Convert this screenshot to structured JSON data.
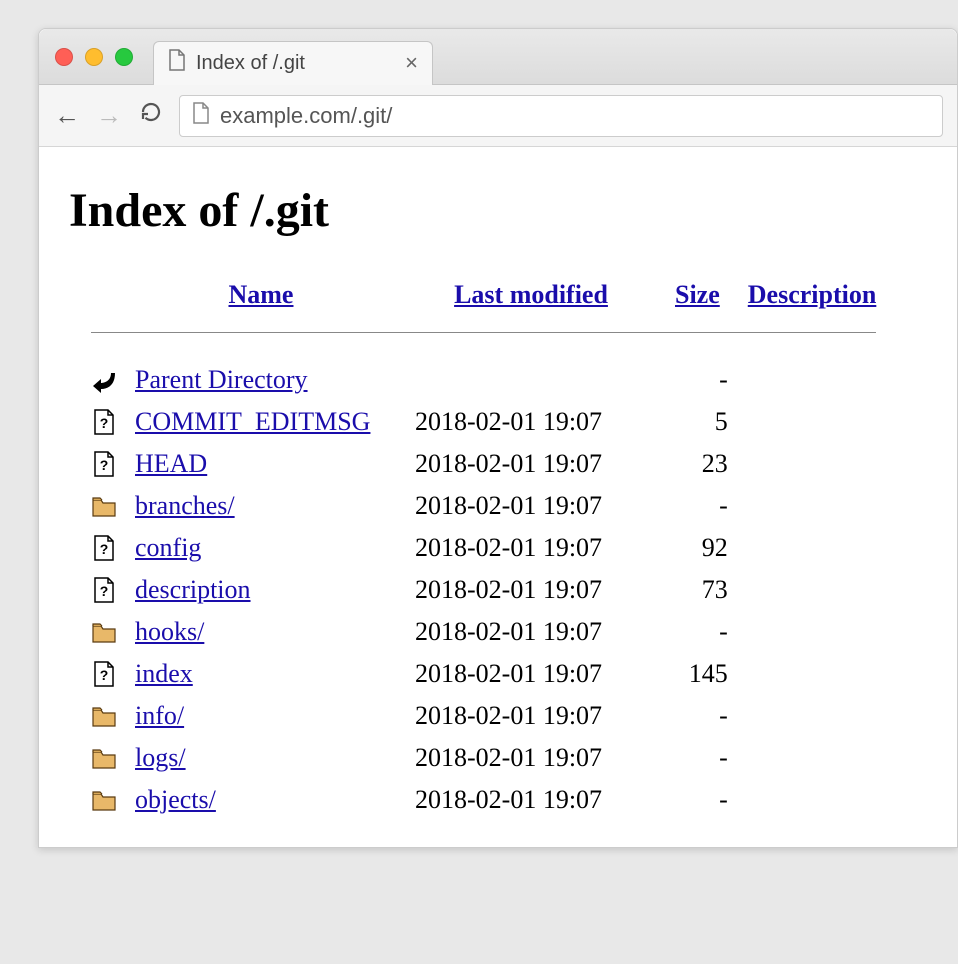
{
  "tab": {
    "title": "Index of /.git"
  },
  "url": "example.com/.git/",
  "heading": "Index of /.git",
  "headers": {
    "name": "Name",
    "modified": "Last modified",
    "size": "Size",
    "description": "Description"
  },
  "rows": [
    {
      "icon": "back",
      "name": "Parent Directory",
      "modified": "",
      "size": "-"
    },
    {
      "icon": "file",
      "name": "COMMIT_EDITMSG",
      "modified": "2018-02-01 19:07",
      "size": "5"
    },
    {
      "icon": "file",
      "name": "HEAD",
      "modified": "2018-02-01 19:07",
      "size": "23"
    },
    {
      "icon": "folder",
      "name": "branches/",
      "modified": "2018-02-01 19:07",
      "size": "-"
    },
    {
      "icon": "file",
      "name": "config",
      "modified": "2018-02-01 19:07",
      "size": "92"
    },
    {
      "icon": "file",
      "name": "description",
      "modified": "2018-02-01 19:07",
      "size": "73"
    },
    {
      "icon": "folder",
      "name": "hooks/",
      "modified": "2018-02-01 19:07",
      "size": "-"
    },
    {
      "icon": "file",
      "name": "index",
      "modified": "2018-02-01 19:07",
      "size": "145"
    },
    {
      "icon": "folder",
      "name": "info/",
      "modified": "2018-02-01 19:07",
      "size": "-"
    },
    {
      "icon": "folder",
      "name": "logs/",
      "modified": "2018-02-01 19:07",
      "size": "-"
    },
    {
      "icon": "folder",
      "name": "objects/",
      "modified": "2018-02-01 19:07",
      "size": "-"
    }
  ]
}
